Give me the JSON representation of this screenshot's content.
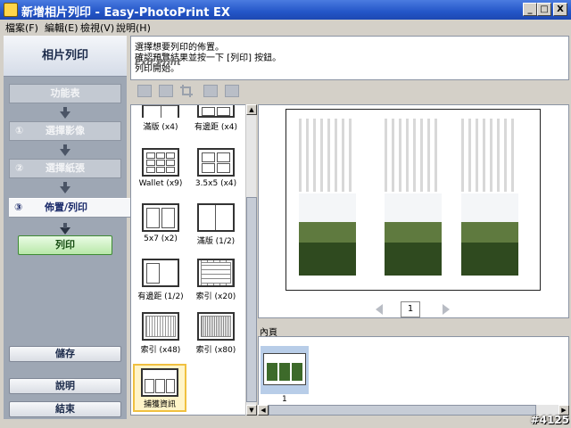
{
  "window": {
    "title": "新增相片列印 - Easy-PhotoPrint EX",
    "min": "_",
    "max": "□",
    "close": "X"
  },
  "menu": [
    "檔案(F)",
    "編輯(E)",
    "檢視(V)",
    "說明(H)"
  ],
  "left": {
    "header": "相片列印",
    "steps": [
      {
        "num": "",
        "label": "功能表"
      },
      {
        "num": "①",
        "label": "選擇影像"
      },
      {
        "num": "②",
        "label": "選擇紙張"
      },
      {
        "num": "③",
        "label": "佈置/列印"
      }
    ],
    "print_button": "列印",
    "save_button": "儲存",
    "help_button": "說明",
    "exit_button": "結束"
  },
  "instructions": [
    "選擇想要列印的佈置。",
    "確認預覽結果並按一下 [列印] 按鈕。",
    "列印開始。"
  ],
  "brand": "Exif Print",
  "layouts": [
    {
      "label": "滿版 (x4)"
    },
    {
      "label": "有邊距 (x4)"
    },
    {
      "label": "Wallet (x9)"
    },
    {
      "label": "3.5x5 (x4)"
    },
    {
      "label": "5x7 (x2)"
    },
    {
      "label": "滿版 (1/2)"
    },
    {
      "label": "有邊距 (1/2)"
    },
    {
      "label": "索引 (x20)"
    },
    {
      "label": "索引 (x48)"
    },
    {
      "label": "索引 (x80)"
    },
    {
      "label": "捕獲資訊",
      "selected": true
    }
  ],
  "preview": {
    "page_number": "1"
  },
  "pages_section": {
    "title": "內頁",
    "thumb_number": "1"
  },
  "watermark": "#4125"
}
